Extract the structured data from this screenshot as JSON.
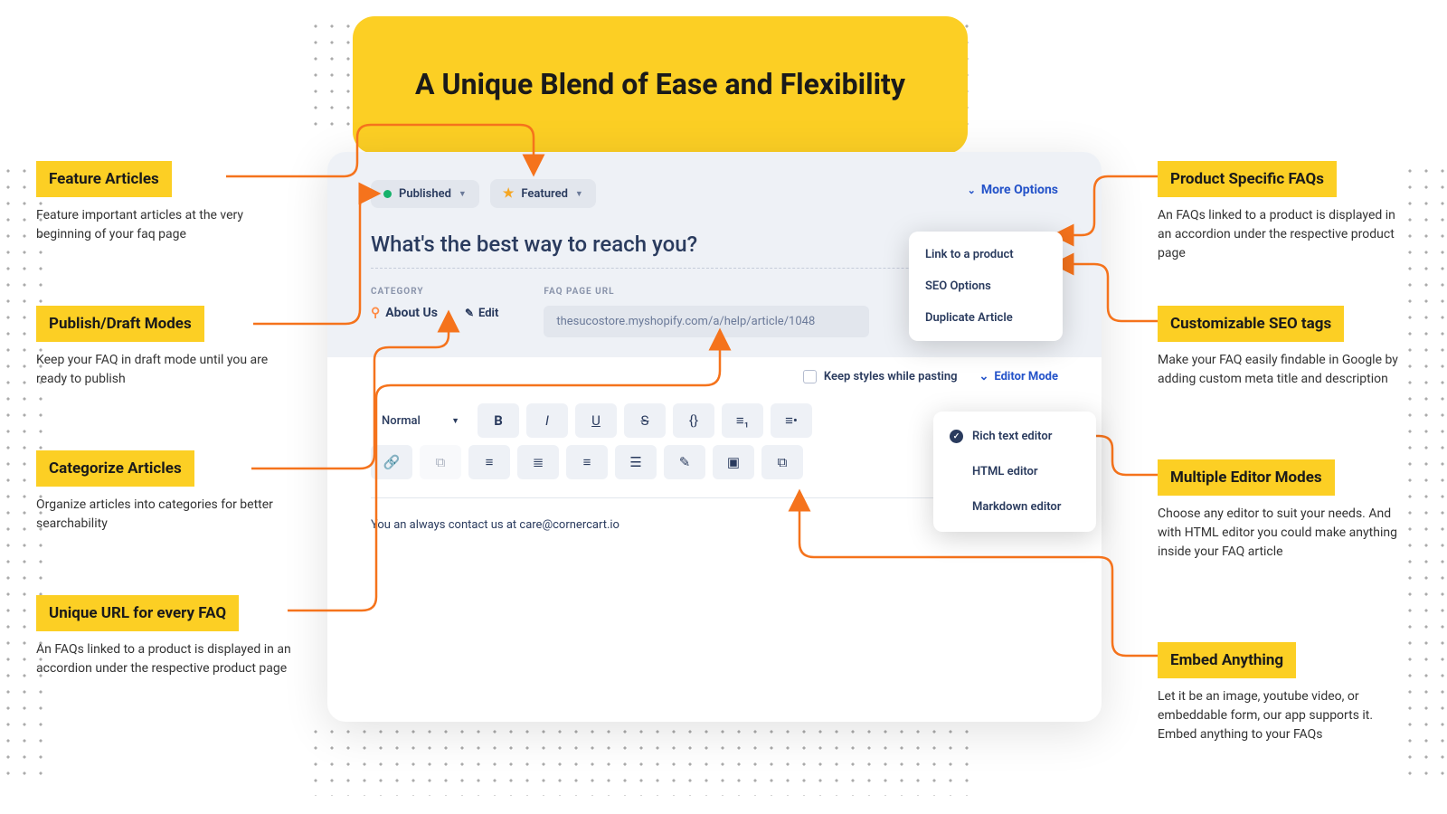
{
  "hero": {
    "title": "A Unique Blend of Ease and Flexibility"
  },
  "callouts": {
    "left": [
      {
        "title": "Feature Articles",
        "body": "Feature important articles at the very beginning of your faq page"
      },
      {
        "title": "Publish/Draft Modes",
        "body": "Keep your FAQ in draft mode until you are ready to publish"
      },
      {
        "title": "Categorize Articles",
        "body": "Organize articles into categories for better searchability"
      },
      {
        "title": "Unique URL for every FAQ",
        "body": "An FAQs linked to a product is displayed in an accordion under the respective product page"
      }
    ],
    "right": [
      {
        "title": "Product Specific FAQs",
        "body": "An FAQs linked to a product is displayed in an accordion under the respective product page"
      },
      {
        "title": "Customizable SEO tags",
        "body": "Make your FAQ easily findable in Google by adding custom meta title and description"
      },
      {
        "title": "Multiple Editor Modes",
        "body": "Choose any editor to suit your needs. And with HTML editor you could make anything inside your FAQ article"
      },
      {
        "title": "Embed Anything",
        "body": "Let it be an image, youtube video, or embeddable form, our app supports it. Embed anything to your FAQs"
      }
    ]
  },
  "editor": {
    "status": {
      "published": "Published",
      "featured": "Featured"
    },
    "more_options_label": "More Options",
    "more_menu": {
      "link_product": "Link to a product",
      "seo_options": "SEO Options",
      "duplicate": "Duplicate Article"
    },
    "question": "What's the best way to reach you?",
    "meta": {
      "category_label": "CATEGORY",
      "category_value": "About Us",
      "edit_label": "Edit",
      "url_label": "FAQ PAGE URL",
      "url_value": "thesucostore.myshopify.com/a/help/article/1048"
    },
    "paste": {
      "keep_styles": "Keep styles while pasting",
      "editor_mode": "Editor Mode"
    },
    "mode_menu": {
      "rich": "Rich text editor",
      "html": "HTML editor",
      "markdown": "Markdown editor"
    },
    "toolbar": {
      "format_normal": "Normal"
    },
    "body_text": "You an always contact us at care@cornercart.io"
  }
}
